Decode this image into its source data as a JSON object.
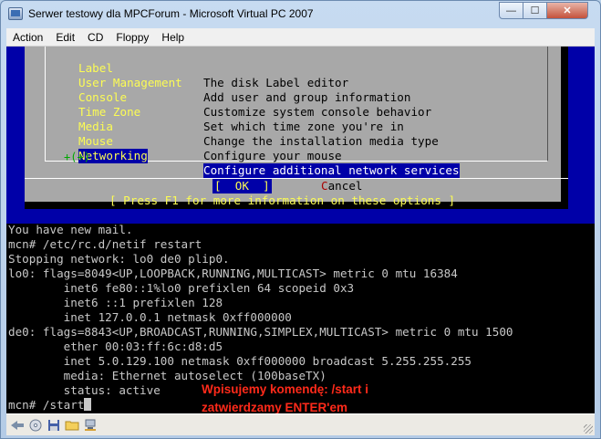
{
  "window": {
    "title": "Serwer testowy dla MPCForum - Microsoft Virtual PC 2007",
    "min_glyph": "—",
    "max_glyph": "☐",
    "close_glyph": "✕"
  },
  "menubar": [
    "Action",
    "Edit",
    "CD",
    "Floppy",
    "Help"
  ],
  "dialog": {
    "scroll_indicator": "+(+)",
    "options": [
      {
        "key": "Label",
        "desc": "The disk Label editor"
      },
      {
        "key": "User Management",
        "desc": "Add user and group information"
      },
      {
        "key": "Console",
        "desc": "Customize system console behavior"
      },
      {
        "key": "Time Zone",
        "desc": "Set which time zone you're in"
      },
      {
        "key": "Media",
        "desc": "Change the installation media type"
      },
      {
        "key": "Mouse",
        "desc": "Configure your mouse"
      },
      {
        "key": "Networking",
        "desc": "Configure additional network services",
        "selected": true
      }
    ],
    "ok_label": "[  OK  ]",
    "cancel_hot": "C",
    "cancel_rest": "ancel",
    "f1_hint": "[ Press F1 for more information on these options ]"
  },
  "console": {
    "lines": [
      "You have new mail.",
      "mcn# /etc/rc.d/netif restart",
      "Stopping network: lo0 de0 plip0.",
      "lo0: flags=8049<UP,LOOPBACK,RUNNING,MULTICAST> metric 0 mtu 16384",
      "        inet6 fe80::1%lo0 prefixlen 64 scopeid 0x3",
      "        inet6 ::1 prefixlen 128",
      "        inet 127.0.0.1 netmask 0xff000000",
      "de0: flags=8843<UP,BROADCAST,RUNNING,SIMPLEX,MULTICAST> metric 0 mtu 1500",
      "        ether 00:03:ff:6c:d8:d5",
      "        inet 5.0.129.100 netmask 0xff000000 broadcast 5.255.255.255",
      "        media: Ethernet autoselect (100baseTX)",
      "        status: active"
    ],
    "prompt_line": "mcn# /start"
  },
  "annotation": {
    "line1": "Wpisujemy komendę: /start i",
    "line2": "zatwierdzamy ENTER'em"
  },
  "statusbar": {
    "icons": [
      "arrow-icon",
      "cd-icon",
      "floppy-icon",
      "folder-icon",
      "network-icon"
    ]
  },
  "colors": {
    "dialog_bg": "#0000a8",
    "dialog_box": "#a8a8a8",
    "hotkey": "#fcfc54",
    "annotation": "#ff2a1a"
  }
}
